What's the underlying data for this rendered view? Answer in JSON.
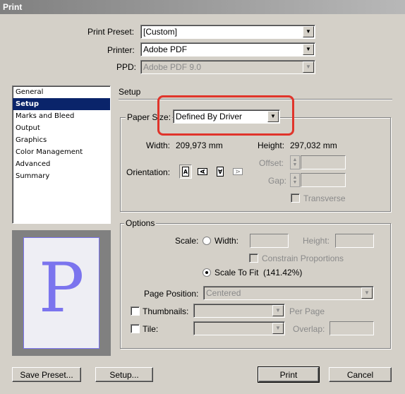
{
  "window": {
    "title": "Print"
  },
  "printer_settings": {
    "preset_label": "Print Preset:",
    "preset_value": "[Custom]",
    "printer_label": "Printer:",
    "printer_value": "Adobe PDF",
    "ppd_label": "PPD:",
    "ppd_value": "Adobe PDF 9.0"
  },
  "sidebar": {
    "items": [
      {
        "label": "General"
      },
      {
        "label": "Setup"
      },
      {
        "label": "Marks and Bleed"
      },
      {
        "label": "Output"
      },
      {
        "label": "Graphics"
      },
      {
        "label": "Color Management"
      },
      {
        "label": "Advanced"
      },
      {
        "label": "Summary"
      }
    ],
    "selected": "Setup"
  },
  "preview": {
    "letter": "P"
  },
  "setup": {
    "section_title": "Setup",
    "paper_size_label": "Paper Size:",
    "paper_size_value": "Defined By Driver",
    "width_label": "Width:",
    "width_value": "209,973 mm",
    "height_label": "Height:",
    "height_value": "297,032 mm",
    "orientation_label": "Orientation:",
    "orientation_icons": [
      "portrait-icon",
      "landscape-icon",
      "reverse-portrait-icon",
      "reverse-landscape-icon"
    ],
    "offset_label": "Offset:",
    "gap_label": "Gap:",
    "transverse_label": "Transverse"
  },
  "options": {
    "legend": "Options",
    "scale_label": "Scale:",
    "width_label": "Width:",
    "height_label": "Height:",
    "constrain_label": "Constrain Proportions",
    "scale_to_fit_label": "Scale To Fit",
    "scale_to_fit_value": "(141.42%)",
    "page_position_label": "Page Position:",
    "page_position_value": "Centered",
    "thumbnails_label": "Thumbnails:",
    "per_page_label": "Per Page",
    "tile_label": "Tile:",
    "overlap_label": "Overlap:"
  },
  "buttons": {
    "save_preset": "Save Preset...",
    "setup": "Setup...",
    "print": "Print",
    "cancel": "Cancel"
  },
  "colors": {
    "selection": "#0a246a",
    "highlight_annotation": "#e0342b",
    "preview_letter": "#7b74ee"
  }
}
